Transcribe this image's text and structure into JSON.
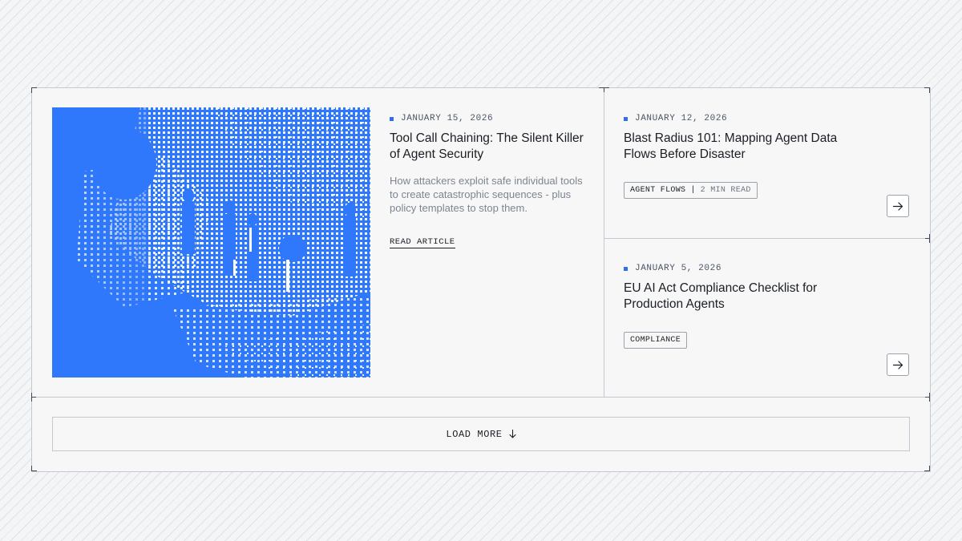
{
  "featured": {
    "date": "JANUARY 15, 2026",
    "title": "Tool Call Chaining: The Silent Killer of Agent Security",
    "description": "How attackers exploit safe individual tools to create catastrophic sequences - plus policy templates to stop them.",
    "link_label": "READ ARTICLE",
    "image_color": "#2f77fb"
  },
  "posts": [
    {
      "date": "JANUARY 12, 2026",
      "title": "Blast Radius 101: Mapping Agent Data Flows Before Disaster",
      "tag": "AGENT FLOWS",
      "separator": "|",
      "read_time": "2 MIN READ",
      "arrow_icon": "arrow-right-icon"
    },
    {
      "date": "JANUARY 5, 2026",
      "title": "EU AI Act Compliance Checklist for Production Agents",
      "tag": "COMPLIANCE",
      "arrow_icon": "arrow-right-icon"
    }
  ],
  "load_more": {
    "label": "LOAD MORE",
    "icon": "arrow-down-icon"
  },
  "colors": {
    "accent": "#2f6fea",
    "border": "#c4c9d1",
    "text": "#1a1e24",
    "muted": "#7d8590"
  }
}
